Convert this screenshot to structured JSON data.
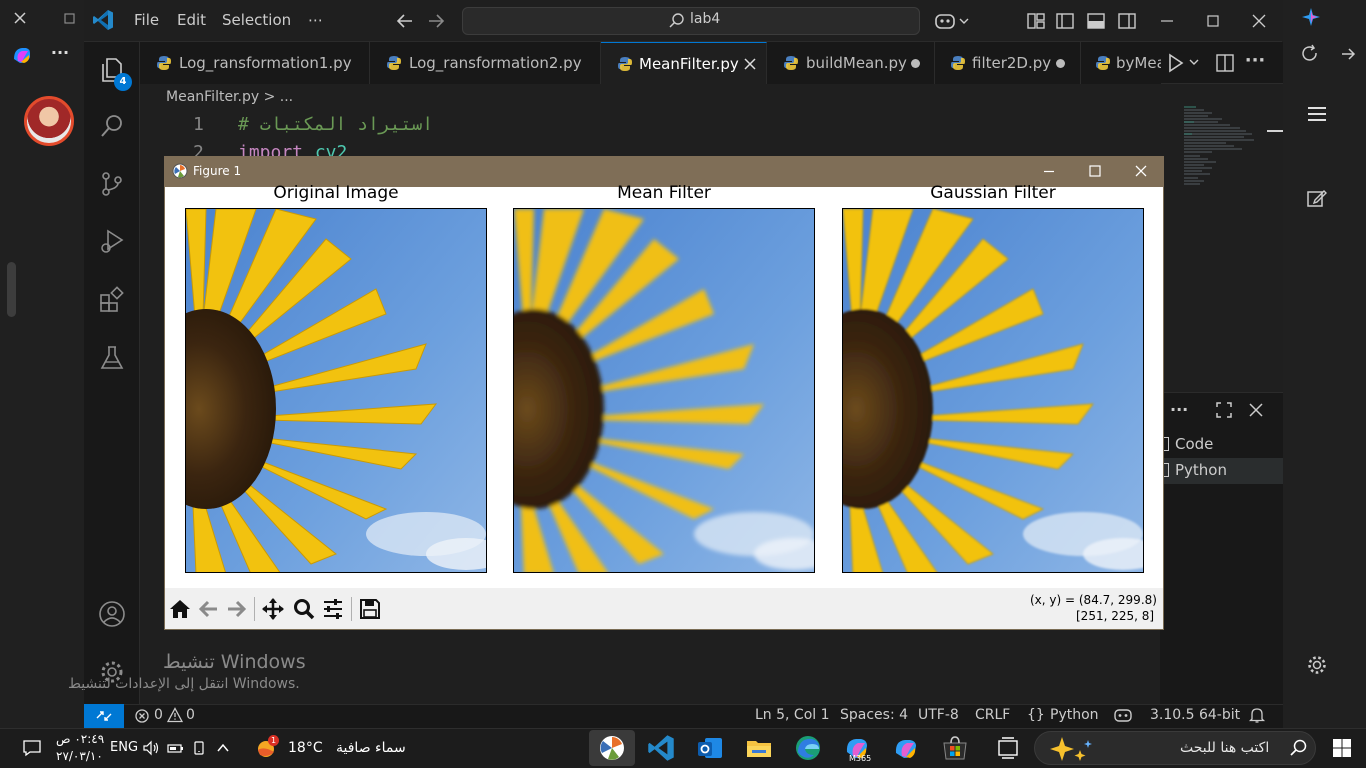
{
  "vscode": {
    "menu": [
      "File",
      "Edit",
      "Selection",
      "⋯"
    ],
    "search": "lab4",
    "explorer_badge": "4",
    "tabs": [
      {
        "label": "Log_ransformation1.py",
        "state": ""
      },
      {
        "label": "Log_ransformation2.py",
        "state": ""
      },
      {
        "label": "MeanFilter.py",
        "state": "active"
      },
      {
        "label": "buildMean.py",
        "state": "modified"
      },
      {
        "label": "filter2D.py",
        "state": "modified"
      },
      {
        "label": "byMea",
        "state": ""
      }
    ],
    "breadcrumb": "MeanFilter.py > ...",
    "code_lines": [
      {
        "no": "1",
        "text": "# استيراد المكتبات"
      },
      {
        "no": "2",
        "keyword": "import",
        "rest": " cv2"
      }
    ],
    "panel_items": [
      "Code",
      "Python"
    ],
    "status": {
      "errors": "0",
      "warnings": "0",
      "position": "Ln 5, Col 1",
      "spaces": "Spaces: 4",
      "encoding": "UTF-8",
      "eol": "CRLF",
      "language": "Python",
      "interpreter": "3.10.5 64-bit"
    }
  },
  "figure": {
    "window_title": "Figure 1",
    "panels": [
      "Original Image",
      "Mean Filter",
      "Gaussian Filter"
    ],
    "coord_readout": "(x, y) = (84.7, 299.8)",
    "pixel_readout": "[251, 225, 8]"
  },
  "watermark": {
    "title": "تنشيط Windows",
    "subtitle": "انتقل إلى الإعدادات لتنشيط Windows."
  },
  "taskbar": {
    "time": "٠٢:٤٩ ص",
    "date": "٢٧/٠٣/١٠",
    "language": "ENG",
    "temperature": "18°C",
    "weather": "سماء صافية",
    "weather_badge": "1",
    "search_placeholder": "اكتب هنا للبحث",
    "m365_label": "M365"
  },
  "colors": {
    "accent": "#0078d4",
    "figure_titlebar": "#7f6e57",
    "sky": "#5b8fd6",
    "petal": "#f2c20f"
  }
}
